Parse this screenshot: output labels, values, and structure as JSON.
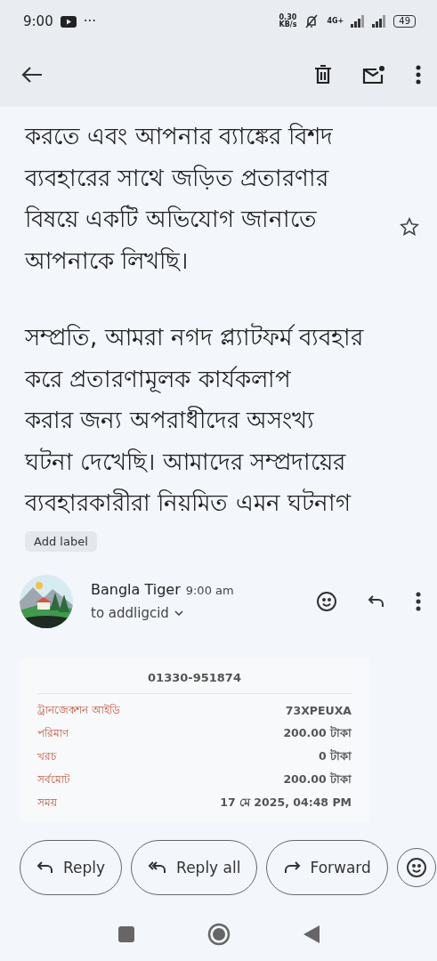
{
  "status_bar": {
    "time": "9:00",
    "more": "···",
    "speed_value": "0.30",
    "speed_unit": "KB/s",
    "network": "4G+",
    "battery": "49"
  },
  "body": {
    "paragraphs": [
      {
        "lines": [
          "করতে এবং আপনার ব্যাঙ্কের বিশদ",
          "ব্যবহারের সাথে জড়িত প্রতারণার",
          "বিষয়ে একটি অভিযোগ জানাতে",
          "আপনাকে লিখছি।"
        ]
      },
      {
        "lines": [
          "সম্প্রতি, আমরা নগদ প্ল্যাটফর্ম ব্যবহার",
          "করে প্রতারণামূলক কার্যকলাপ",
          "করার জন্য অপরাধীদের অসংখ্য",
          "ঘটনা দেখেছি। আমাদের সম্প্রদায়ের",
          "ব্যবহারকারীরা নিয়মিত এমন ঘটনাগ"
        ]
      }
    ],
    "starred": false
  },
  "label_chip": "Add label",
  "message": {
    "sender": "Bangla Tiger",
    "time": "9:00 am",
    "recipient": "to addligcid"
  },
  "receipt": {
    "phone": "01330-951874",
    "rows": [
      {
        "label": "ট্রানজেকশন আইডি",
        "value": "73XPEUXA"
      },
      {
        "label": "পরিমাণ",
        "value": "200.00 টাকা"
      },
      {
        "label": "খরচ",
        "value": "0 টাকা"
      },
      {
        "label": "সর্বমোট",
        "value": "200.00 টাকা"
      },
      {
        "label": "সময়",
        "value": "17 মে 2025, 04:48 PM"
      }
    ]
  },
  "actions": [
    {
      "kind": "reply",
      "label": "Reply"
    },
    {
      "kind": "reply_all",
      "label": "Reply all"
    },
    {
      "kind": "forward",
      "label": "Forward"
    }
  ]
}
